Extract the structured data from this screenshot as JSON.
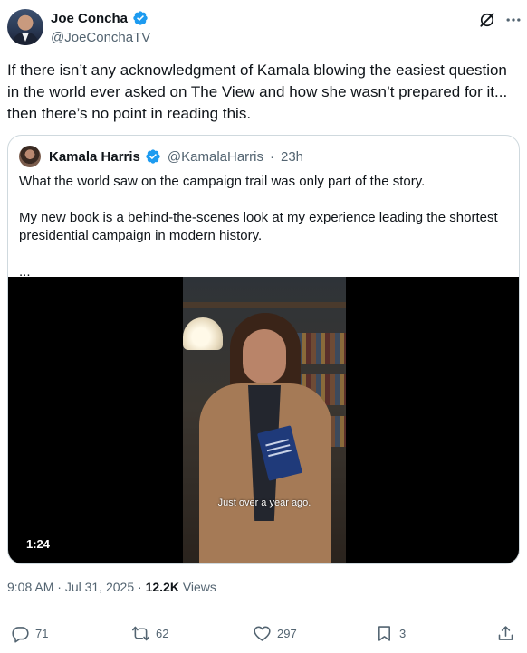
{
  "author": {
    "display_name": "Joe Concha",
    "handle": "@JoeConchaTV",
    "verified_color": "#1d9bf0"
  },
  "icons": {
    "grok": "grok-icon",
    "more": "more-icon"
  },
  "tweet": {
    "text": "If there isn’t any acknowledgment of Kamala blowing the easiest question in the world ever asked on The View and how she wasn’t prepared for it... then there’s no point in reading this."
  },
  "quote": {
    "display_name": "Kamala Harris",
    "handle": "@KamalaHarris",
    "separator": "·",
    "time": "23h",
    "paragraphs": [
      "What the world saw on the campaign trail was only part of the story.",
      "My new book is a behind-the-scenes look at my experience leading the shortest presidential campaign in modern history.",
      "..."
    ],
    "video": {
      "caption": "Just over a year ago.",
      "duration": "1:24"
    }
  },
  "meta": {
    "time": "9:08 AM",
    "separator": "·",
    "date": "Jul 31, 2025",
    "separator2": "·",
    "views_count": "12.2K",
    "views_label": "Views"
  },
  "actions": {
    "replies": "71",
    "reposts": "62",
    "likes": "297",
    "bookmarks": "3"
  }
}
